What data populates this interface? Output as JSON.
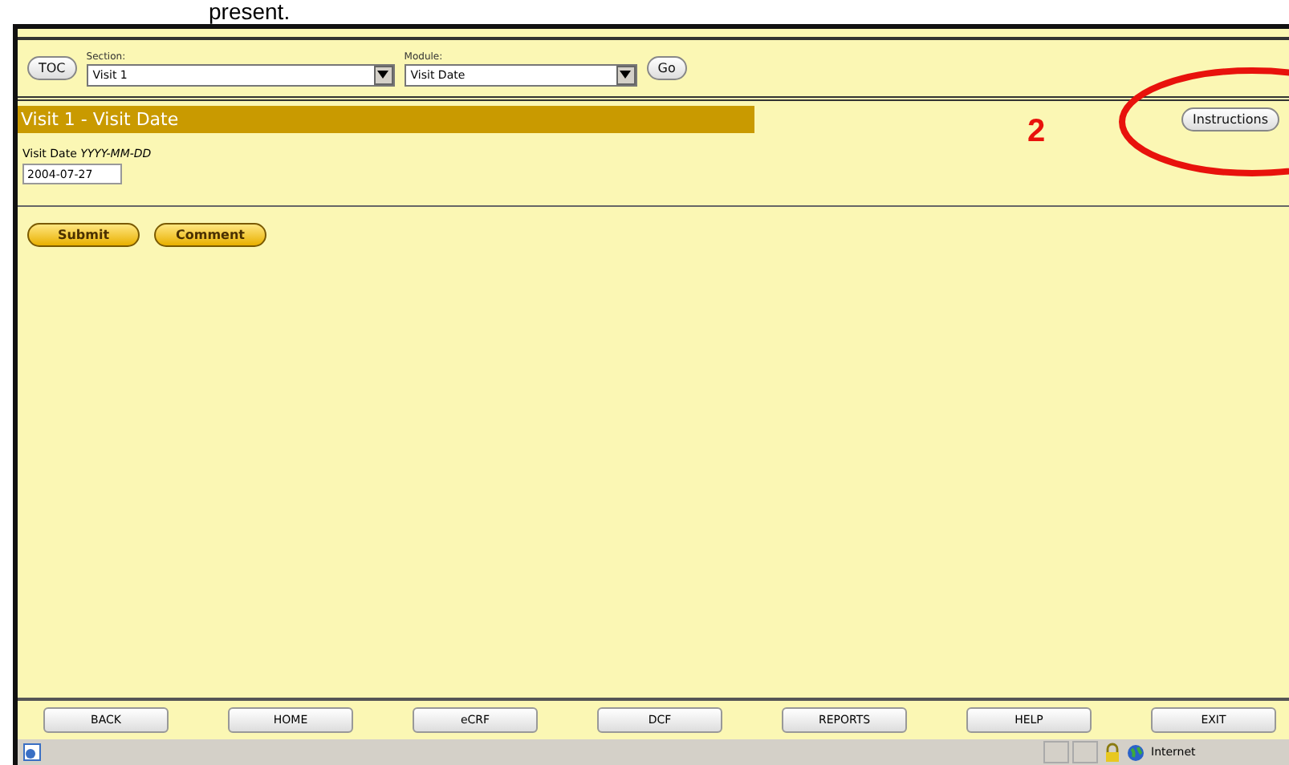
{
  "caption": "present.",
  "toolbar": {
    "toc_button": "TOC",
    "section": {
      "label": "Section:",
      "value": "Visit 1"
    },
    "module": {
      "label": "Module:",
      "value": "Visit Date"
    },
    "go_button": "Go"
  },
  "form": {
    "title": "Visit 1 - Visit Date",
    "instructions_button": "Instructions",
    "field_label": "Visit Date",
    "field_format": "YYYY-MM-DD",
    "field_value": "2004-07-27",
    "buttons": [
      "Submit",
      "Comment"
    ]
  },
  "annotation": {
    "number": "2"
  },
  "nav_buttons": [
    "BACK",
    "HOME",
    "eCRF",
    "DCF",
    "REPORTS",
    "HELP",
    "EXIT"
  ],
  "status_bar": {
    "zone": "Internet"
  }
}
